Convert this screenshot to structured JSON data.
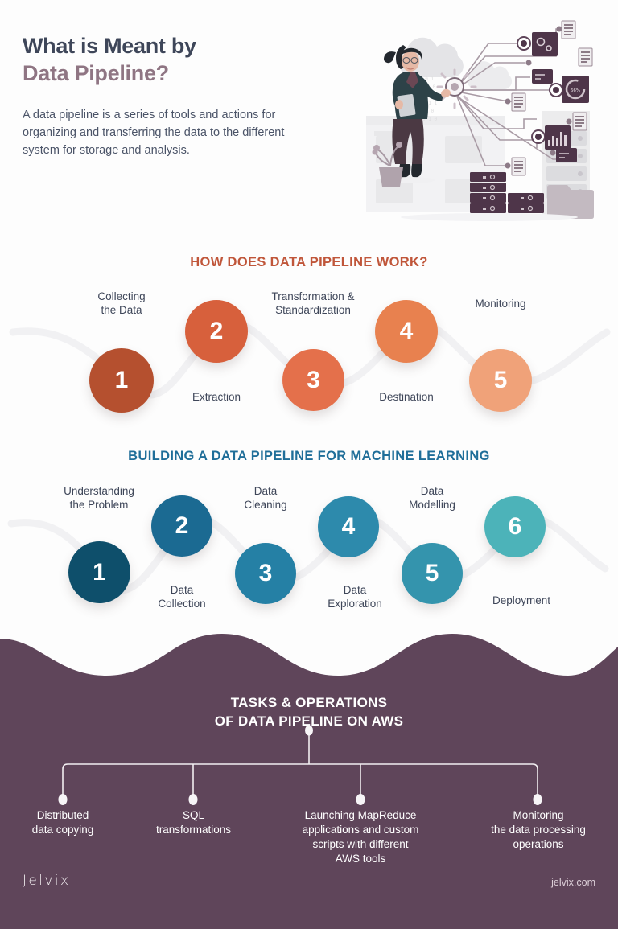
{
  "hero": {
    "title_line1": "What is Meant by",
    "title_line2": "Data Pipeline?",
    "body": "A data pipeline is a series of tools and actions for organizing and transferring the data to the different system for storage and analysis.",
    "illustration_name": "data-pipeline-illustration"
  },
  "colors": {
    "title_dark": "#3e4659",
    "title_mauve": "#8f7583",
    "heading_orange": "#c0563a",
    "heading_blue": "#1f6e99",
    "panel_purple": "#5f455a",
    "label_text": "#3e4659"
  },
  "section_orange": {
    "heading": "HOW DOES DATA PIPELINE WORK?",
    "steps": [
      {
        "number": "1",
        "label": "Collecting\nthe Data",
        "color": "#b5502f",
        "label_position": "above"
      },
      {
        "number": "2",
        "label": "Extraction",
        "color": "#d7603c",
        "label_position": "below"
      },
      {
        "number": "3",
        "label": "Transformation &\nStandardization",
        "color": "#e4704b",
        "label_position": "above"
      },
      {
        "number": "4",
        "label": "Destination",
        "color": "#e8814f",
        "label_position": "below"
      },
      {
        "number": "5",
        "label": "Monitoring",
        "color": "#f0a279",
        "label_position": "above"
      }
    ]
  },
  "section_blue": {
    "heading": "BUILDING A DATA PIPELINE FOR MACHINE LEARNING",
    "steps": [
      {
        "number": "1",
        "label": "Understanding\nthe Problem",
        "color": "#0e4f6b",
        "label_position": "above"
      },
      {
        "number": "2",
        "label": "Data\nCollection",
        "color": "#1b6a92",
        "label_position": "below"
      },
      {
        "number": "3",
        "label": "Data\nCleaning",
        "color": "#2580a5",
        "label_position": "above"
      },
      {
        "number": "4",
        "label": "Data\nExploration",
        "color": "#2d8aac",
        "label_position": "below"
      },
      {
        "number": "5",
        "label": "Data\nModelling",
        "color": "#3494ad",
        "label_position": "above"
      },
      {
        "number": "6",
        "label": "Deployment",
        "color": "#4cb3b9",
        "label_position": "below"
      }
    ]
  },
  "section_tasks": {
    "title_line1": "TASKS & OPERATIONS",
    "title_line2": "OF DATA PIPELINE ON AWS",
    "items": [
      {
        "label": "Distributed\ndata copying"
      },
      {
        "label": "SQL\ntransformations"
      },
      {
        "label": "Launching MapReduce\napplications and custom\nscripts with different\nAWS tools"
      },
      {
        "label": "Monitoring\nthe data processing\noperations"
      }
    ]
  },
  "footer": {
    "brand": "Jelvix",
    "url": "jelvix.com"
  }
}
